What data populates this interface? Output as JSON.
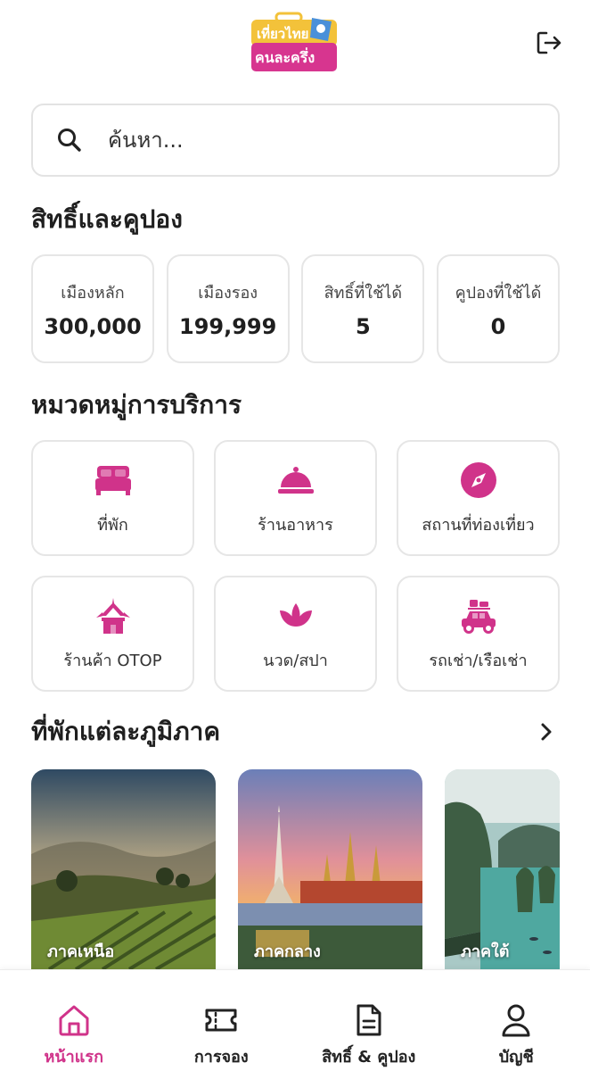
{
  "colors": {
    "accent": "#d0338a",
    "logo_yellow": "#f3c23a",
    "logo_magenta": "#d7358f",
    "card_border": "#e6e6e6"
  },
  "header": {
    "logo": {
      "line1": "เที่ยวไทย",
      "line2": "คนละครึ่ง"
    },
    "logout_icon": "logout-icon"
  },
  "search": {
    "placeholder": "ค้นหา..."
  },
  "rights": {
    "title": "สิทธิ์และคูปอง",
    "cards": [
      {
        "label": "เมืองหลัก",
        "value": "300,000"
      },
      {
        "label": "เมืองรอง",
        "value": "199,999"
      },
      {
        "label": "สิทธิ์ที่ใช้ได้",
        "value": "5"
      },
      {
        "label": "คูปองที่ใช้ได้",
        "value": "0"
      }
    ]
  },
  "categories": {
    "title": "หมวดหมู่การบริการ",
    "items": [
      {
        "label": "ที่พัก",
        "icon": "bed-icon"
      },
      {
        "label": "ร้านอาหาร",
        "icon": "food-cloche-icon"
      },
      {
        "label": "สถานที่ท่องเที่ยว",
        "icon": "compass-icon"
      },
      {
        "label": "ร้านค้า OTOP",
        "icon": "thai-pavilion-icon"
      },
      {
        "label": "นวด/สปา",
        "icon": "lotus-icon"
      },
      {
        "label": "รถเช่า/เรือเช่า",
        "icon": "car-luggage-icon"
      }
    ]
  },
  "regions": {
    "title": "ที่พักแต่ละภูมิภาค",
    "items": [
      {
        "label": "ภาคเหนือ"
      },
      {
        "label": "ภาคกลาง"
      },
      {
        "label": "ภาคใต้"
      }
    ]
  },
  "bottom_nav": {
    "items": [
      {
        "label": "หน้าแรก",
        "icon": "home-icon",
        "active": true
      },
      {
        "label": "การจอง",
        "icon": "ticket-icon",
        "active": false
      },
      {
        "label": "สิทธิ์ & คูปอง",
        "icon": "document-icon",
        "active": false
      },
      {
        "label": "บัญชี",
        "icon": "user-icon",
        "active": false
      }
    ]
  }
}
